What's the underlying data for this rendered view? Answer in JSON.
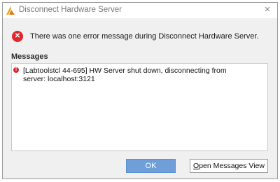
{
  "window": {
    "title": "Disconnect Hardware Server",
    "app_icon": "vivado-icon",
    "close_icon": "close-icon",
    "close_glyph": "×"
  },
  "summary": {
    "icon": "error-icon",
    "icon_glyph": "✕",
    "text": "There was one error message during Disconnect Hardware Server."
  },
  "messages": {
    "heading": "Messages",
    "items": [
      {
        "icon": "error-dot-icon",
        "icon_glyph": "!",
        "text": "[Labtoolstcl 44-695] HW Server shut down, disconnecting from server: localhost:3121"
      }
    ]
  },
  "buttons": {
    "ok_label": "OK",
    "open_messages_mnemonic": "O",
    "open_messages_rest": "pen Messages View"
  },
  "colors": {
    "error_red": "#e0282e",
    "ok_button_blue": "#6f9fd8",
    "dialog_bg": "#f0f0f0"
  }
}
